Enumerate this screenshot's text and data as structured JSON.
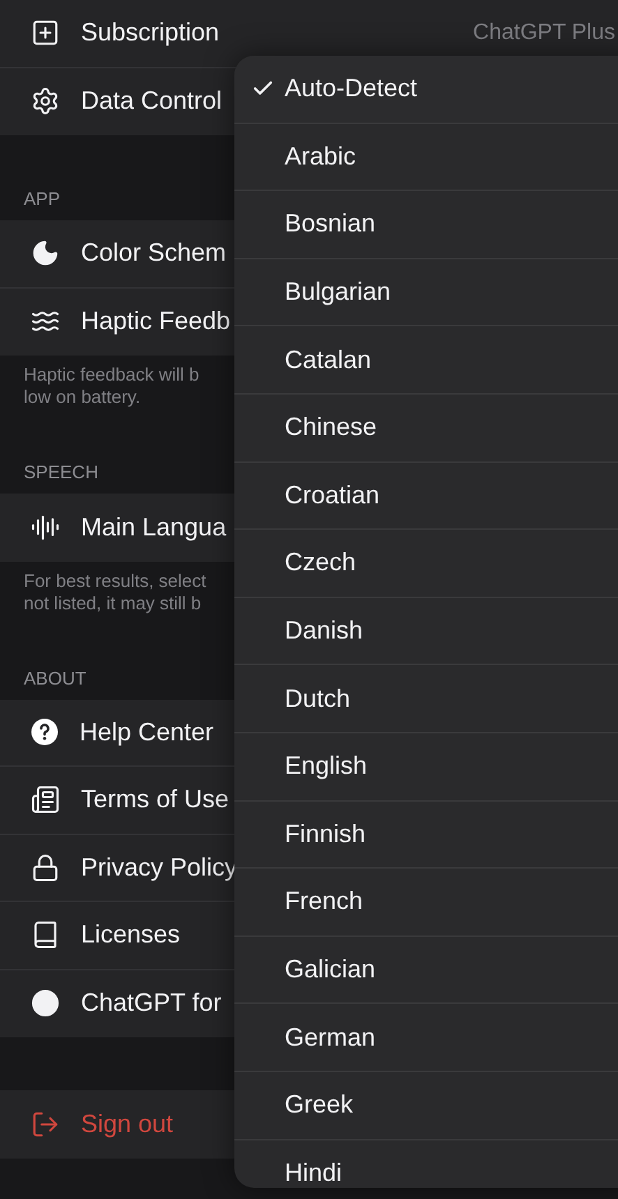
{
  "sections": [
    {
      "rows": [
        {
          "label": "Subscription",
          "value": "ChatGPT Plus"
        },
        {
          "label": "Data Control"
        }
      ]
    },
    {
      "header": "APP",
      "rows": [
        {
          "label": "Color Schem"
        },
        {
          "label": "Haptic Feedb"
        }
      ],
      "footer": "Haptic feedback will b\nlow on battery."
    },
    {
      "header": "SPEECH",
      "rows": [
        {
          "label": "Main Langua"
        }
      ],
      "footer": "For best results, select\nnot listed, it may still b"
    },
    {
      "header": "ABOUT",
      "rows": [
        {
          "label": "Help Center"
        },
        {
          "label": "Terms of Use"
        },
        {
          "label": "Privacy Policy"
        },
        {
          "label": "Licenses"
        },
        {
          "label": "ChatGPT for"
        }
      ]
    },
    {
      "rows": [
        {
          "label": "Sign out",
          "kind": "destructive"
        }
      ]
    }
  ],
  "language_menu": [
    {
      "label": "Auto-Detect",
      "selected": true
    },
    {
      "label": "Arabic",
      "selected": false
    },
    {
      "label": "Bosnian",
      "selected": false
    },
    {
      "label": "Bulgarian",
      "selected": false
    },
    {
      "label": "Catalan",
      "selected": false
    },
    {
      "label": "Chinese",
      "selected": false
    },
    {
      "label": "Croatian",
      "selected": false
    },
    {
      "label": "Czech",
      "selected": false
    },
    {
      "label": "Danish",
      "selected": false
    },
    {
      "label": "Dutch",
      "selected": false
    },
    {
      "label": "English",
      "selected": false
    },
    {
      "label": "Finnish",
      "selected": false
    },
    {
      "label": "French",
      "selected": false
    },
    {
      "label": "Galician",
      "selected": false
    },
    {
      "label": "German",
      "selected": false
    },
    {
      "label": "Greek",
      "selected": false
    },
    {
      "label": "Hindi",
      "selected": false
    }
  ]
}
